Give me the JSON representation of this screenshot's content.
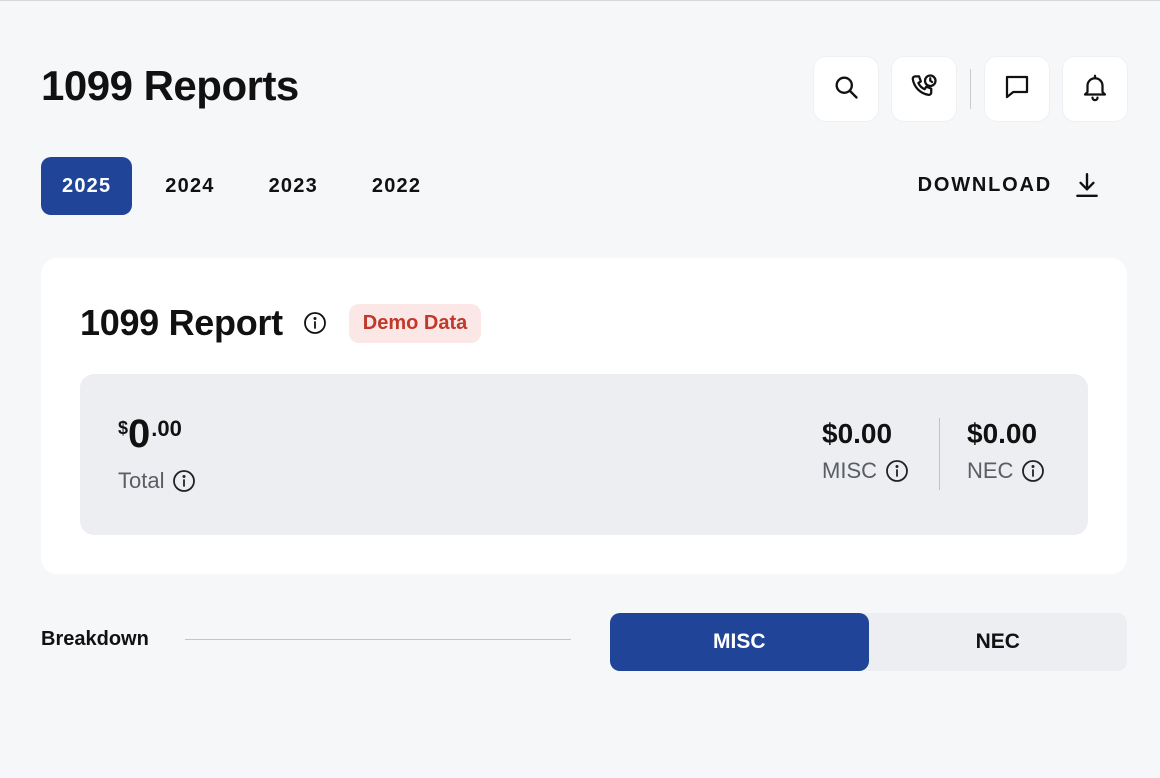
{
  "page": {
    "title": "1099 Reports"
  },
  "header_actions": [
    "search-icon",
    "phone-clock-icon",
    "chat-icon",
    "bell-icon"
  ],
  "year_tabs": [
    {
      "label": "2025",
      "active": true
    },
    {
      "label": "2024",
      "active": false
    },
    {
      "label": "2023",
      "active": false
    },
    {
      "label": "2022",
      "active": false
    }
  ],
  "download": {
    "label": "DOWNLOAD",
    "icon": "download-icon"
  },
  "report": {
    "title": "1099 Report",
    "badge": "Demo Data",
    "total": {
      "currency": "$",
      "integer": "0",
      "cents": ".00",
      "label": "Total"
    },
    "misc": {
      "value": "$0.00",
      "label": "MISC"
    },
    "nec": {
      "value": "$0.00",
      "label": "NEC"
    }
  },
  "breakdown": {
    "label": "Breakdown",
    "segments": [
      {
        "label": "MISC",
        "active": true
      },
      {
        "label": "NEC",
        "active": false
      }
    ]
  },
  "colors": {
    "accent": "#1f4498",
    "badge_bg": "#fbe8e6",
    "badge_text": "#c0392b",
    "background": "#f6f7f9"
  }
}
